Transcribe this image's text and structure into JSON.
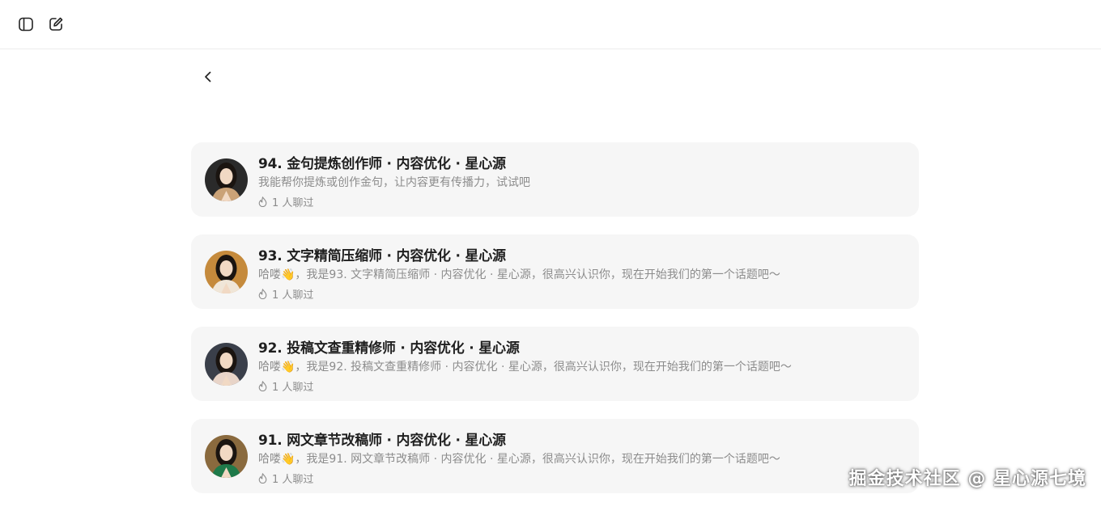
{
  "header": {
    "sidebar_toggle_icon": "sidebar-toggle-icon",
    "new_chat_icon": "edit-icon"
  },
  "navigation": {
    "back_icon": "chevron-left-icon"
  },
  "colors": {
    "card_bg": "#f6f6f6",
    "title": "#1f1f1f",
    "muted": "#8c8c8c"
  },
  "bots": [
    {
      "title": "94. 金句提炼创作师 · 内容优化 · 星心源",
      "description": "我能帮你提炼或创作金句，让内容更有传播力，试试吧",
      "chat_count": "1 人聊过",
      "avatar_icon": "avatar-image",
      "avatar_bg": "#2a2a2a",
      "avatar_accent": "#caa277"
    },
    {
      "title": "93. 文字精简压缩师 · 内容优化 · 星心源",
      "description": "哈喽👋，我是93. 文字精简压缩师 · 内容优化 · 星心源，很高兴认识你，现在开始我们的第一个话题吧～",
      "chat_count": "1 人聊过",
      "avatar_icon": "avatar-image",
      "avatar_bg": "#c58a3c",
      "avatar_accent": "#f0e6d8"
    },
    {
      "title": "92. 投稿文查重精修师 · 内容优化 · 星心源",
      "description": "哈喽👋，我是92. 投稿文查重精修师 · 内容优化 · 星心源，很高兴认识你，现在开始我们的第一个话题吧～",
      "chat_count": "1 人聊过",
      "avatar_icon": "avatar-image",
      "avatar_bg": "#3a3f4a",
      "avatar_accent": "#e8d4c8"
    },
    {
      "title": "91. 网文章节改稿师 · 内容优化 · 星心源",
      "description": "哈喽👋，我是91. 网文章节改稿师 · 内容优化 · 星心源，很高兴认识你，现在开始我们的第一个话题吧～",
      "chat_count": "1 人聊过",
      "avatar_icon": "avatar-image",
      "avatar_bg": "#8a6a3e",
      "avatar_accent": "#1f7a4a"
    }
  ],
  "watermark": "掘金技术社区 @ 星心源七境"
}
